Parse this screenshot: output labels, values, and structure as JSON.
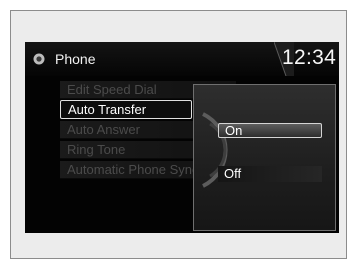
{
  "header": {
    "title": "Phone",
    "clock": "12:34",
    "icon": "phone-icon"
  },
  "menu": {
    "items": [
      {
        "label": "Edit Speed Dial"
      },
      {
        "label": "Auto Transfer"
      },
      {
        "label": "Auto Answer"
      },
      {
        "label": "Ring Tone"
      },
      {
        "label": "Automatic Phone Sync"
      }
    ],
    "selected": "Auto Transfer"
  },
  "popup": {
    "options": [
      {
        "label": "On"
      },
      {
        "label": "Off"
      }
    ],
    "highlighted": "On"
  },
  "colors": {
    "screen_bg": "#030303",
    "highlight_border": "#d4d4d4",
    "dim_text": "#4d4d4d"
  }
}
